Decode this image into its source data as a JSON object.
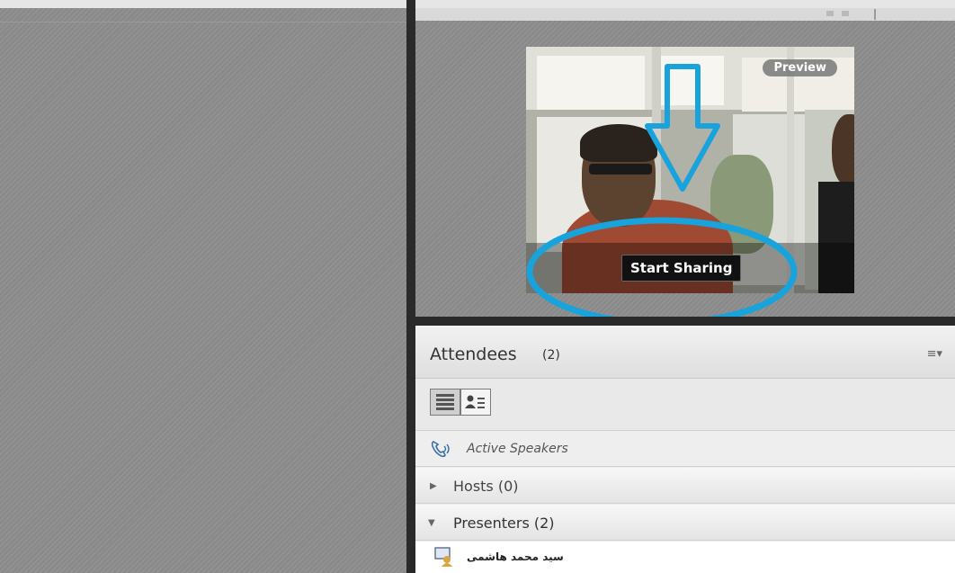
{
  "video": {
    "preview_label": "Preview",
    "start_sharing_label": "Start Sharing"
  },
  "attendees": {
    "title": "Attendees",
    "count": "(2)",
    "menu_glyph": "≡▾",
    "active_speakers_label": "Active Speakers",
    "groups": [
      {
        "label": "Hosts (0)",
        "expanded": false
      },
      {
        "label": "Presenters (2)",
        "expanded": true
      }
    ],
    "presenter_name": "سيد محمد هاشمی"
  },
  "icons": {
    "speaker": "phone-speaker-icon",
    "list_view": "list-view-icon",
    "card_view": "user-list-icon",
    "presenter": "presenter-webcam-icon"
  },
  "colors": {
    "annotation": "#19a3dd",
    "pod_background": "#8a8a8a",
    "divider": "#2a2a2a"
  }
}
